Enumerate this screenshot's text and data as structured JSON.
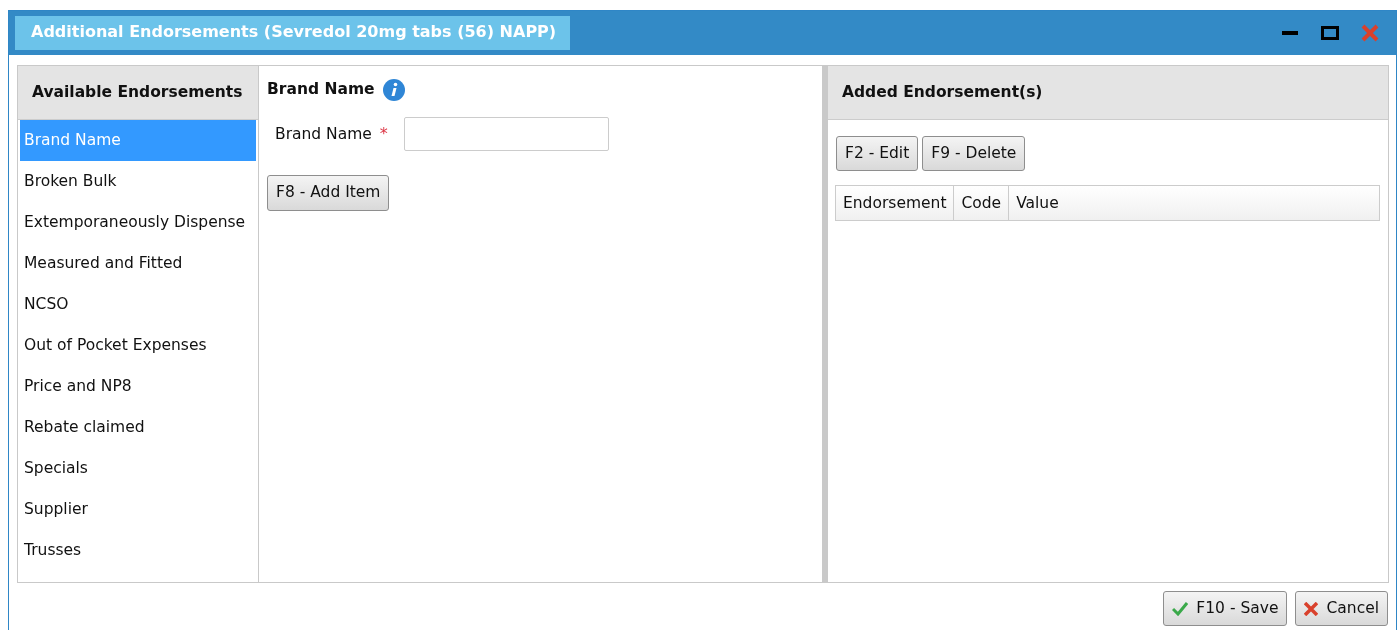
{
  "window": {
    "title": "Additional Endorsements (Sevredol 20mg tabs (56) NAPP)"
  },
  "available": {
    "heading": "Available Endorsements",
    "items": [
      {
        "label": "Brand Name",
        "selected": true
      },
      {
        "label": "Broken Bulk",
        "selected": false
      },
      {
        "label": "Extemporaneously Dispense",
        "selected": false
      },
      {
        "label": "Measured and Fitted",
        "selected": false
      },
      {
        "label": "NCSO",
        "selected": false
      },
      {
        "label": "Out of Pocket Expenses",
        "selected": false
      },
      {
        "label": "Price and NP8",
        "selected": false
      },
      {
        "label": "Rebate claimed",
        "selected": false
      },
      {
        "label": "Specials",
        "selected": false
      },
      {
        "label": "Supplier",
        "selected": false
      },
      {
        "label": "Trusses",
        "selected": false
      }
    ]
  },
  "form": {
    "heading": "Brand Name",
    "field_label": "Brand Name",
    "required_mark": "*",
    "add_button": "F8 - Add Item"
  },
  "added": {
    "heading": "Added Endorsement(s)",
    "buttons": [
      "F2 - Edit",
      "F9 - Delete"
    ],
    "columns": [
      "Endorsement",
      "Code",
      "Value"
    ]
  },
  "footer": {
    "buttons": [
      {
        "label": "F10 - Save",
        "kind": "save"
      },
      {
        "label": "Cancel",
        "kind": "cancel"
      }
    ]
  }
}
